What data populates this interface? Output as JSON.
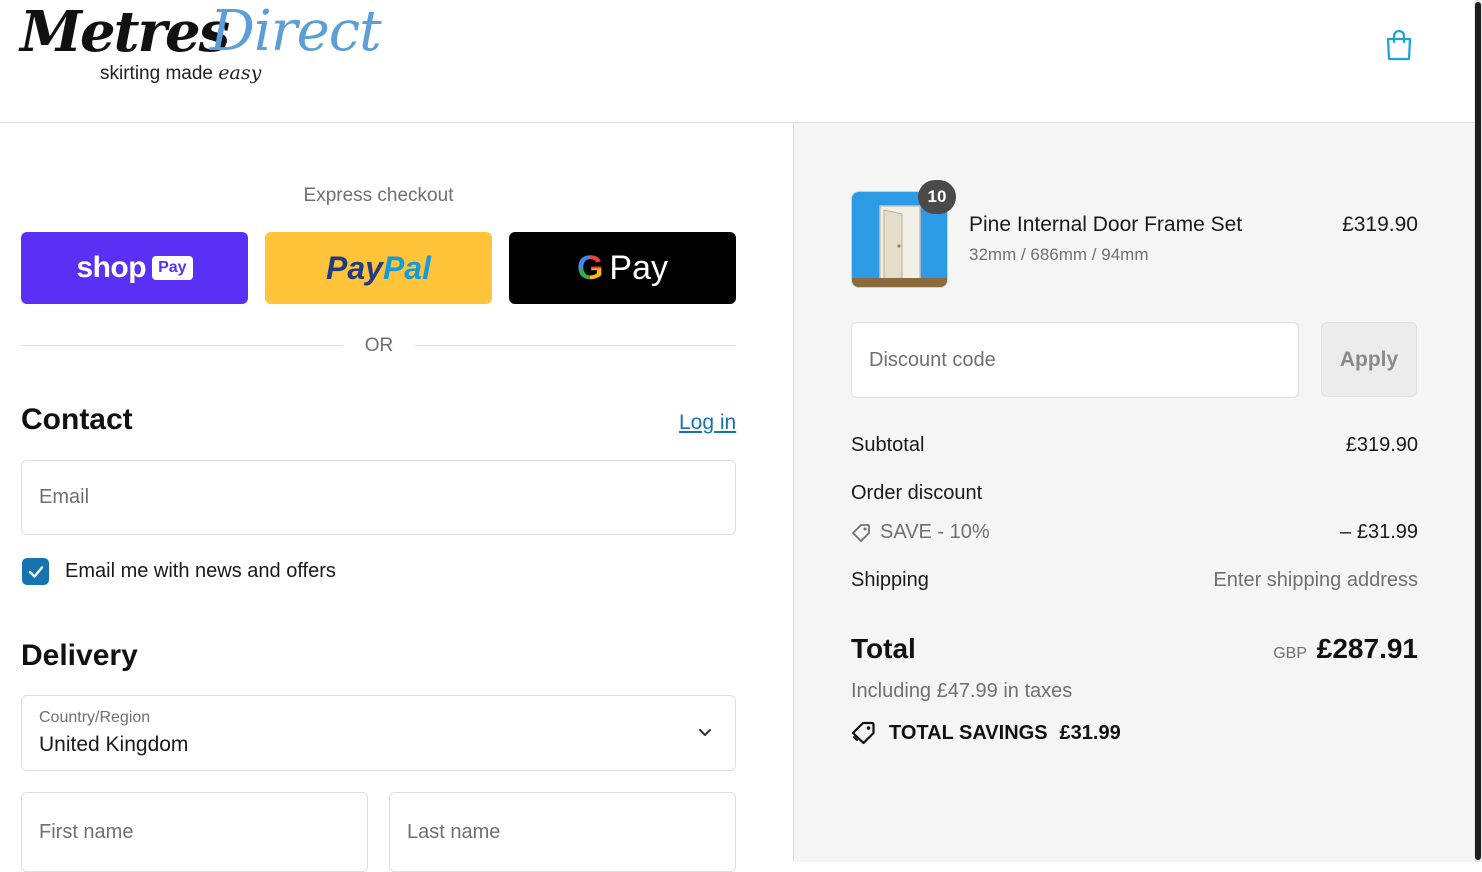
{
  "header": {
    "logo_word1": "Metres",
    "logo_word2": "Direct",
    "logo_tagline_main": "skirting made ",
    "logo_tagline_em": "easy",
    "cart_icon": "shopping-bag-icon"
  },
  "express": {
    "title": "Express checkout",
    "shop_pay_word": "shop",
    "shop_pay_pill": "Pay",
    "paypal_word1": "Pay",
    "paypal_word2": "Pal",
    "gpay_g": "G",
    "gpay_word": "Pay",
    "or_text": "OR",
    "colors": {
      "shop_pay": "#5a31f4",
      "paypal": "#ffc439",
      "gpay": "#000000"
    }
  },
  "contact": {
    "title": "Contact",
    "login_link": "Log in",
    "email_placeholder": "Email",
    "email_value": "",
    "newsletter_checked": true,
    "newsletter_label": "Email me with news and offers"
  },
  "delivery": {
    "title": "Delivery",
    "country_label": "Country/Region",
    "country_value": "United Kingdom",
    "first_name_placeholder": "First name",
    "last_name_placeholder": "Last name"
  },
  "summary": {
    "product": {
      "name": "Pine Internal Door Frame Set",
      "variant": "32mm / 686mm / 94mm",
      "price": "£319.90",
      "quantity": "10"
    },
    "discount_placeholder": "Discount code",
    "apply_label": "Apply",
    "subtotal_label": "Subtotal",
    "subtotal_value": "£319.90",
    "order_discount_label": "Order discount",
    "discount_code_label": "SAVE - 10%",
    "discount_value": "– £31.99",
    "shipping_label": "Shipping",
    "shipping_value": "Enter shipping address",
    "total_label": "Total",
    "currency": "GBP",
    "total_value": "£287.91",
    "tax_note": "Including £47.99 in taxes",
    "savings_label": "TOTAL SAVINGS",
    "savings_value": "£31.99"
  },
  "theme": {
    "accent": "#1773b0",
    "panel_bg": "#f5f5f5"
  }
}
